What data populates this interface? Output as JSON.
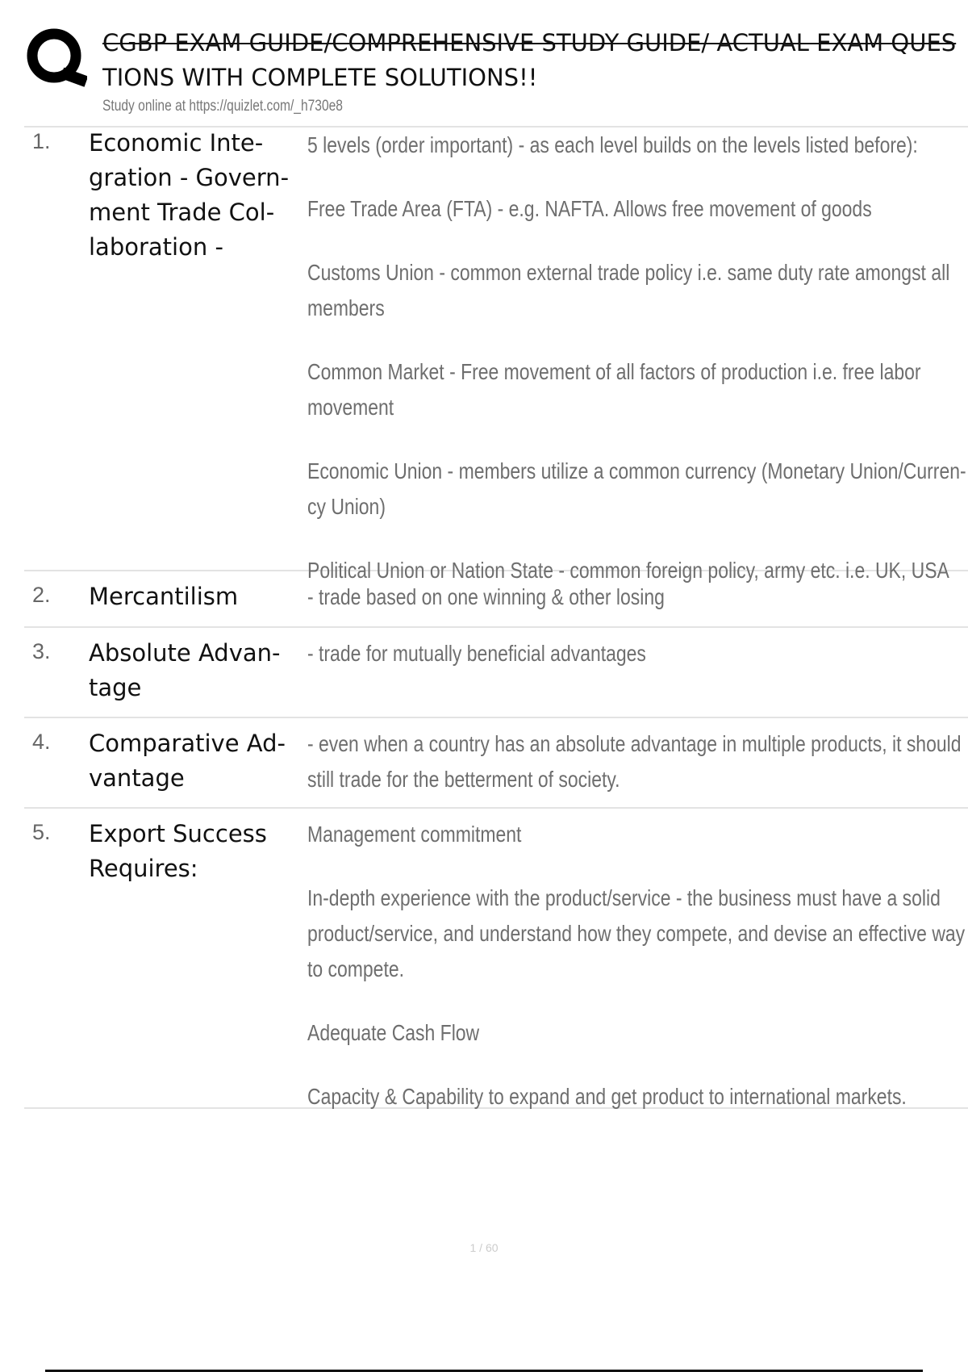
{
  "header": {
    "logo_icon": "quizlet-q-logo",
    "title_line1": "CGBP EXAM GUIDE/COMPREHENSIVE STUDY GUIDE/ ACTUAL EXAM QUES",
    "title_line2": "TIONS WITH COMPLETE SOLUTIONS!!",
    "study_link": "Study online at https://quizlet.com/_h730e8"
  },
  "terms": [
    {
      "num": "1.",
      "term": "Economic Inte-\ngration - Govern-\nment Trade Col-\nlaboration -",
      "definitions": [
        [
          "5 levels (order important) - as each level builds on the levels listed before):"
        ],
        [
          "Free Trade Area (FTA) - e.g. NAFTA. Allows free movement of goods"
        ],
        [
          "Customs Union - common external trade policy i.e. same duty rate amongst all",
          "members"
        ],
        [
          "Common Market - Free movement of all factors of production i.e. free labor",
          "movement"
        ],
        [
          "Economic Union - members utilize a common currency (Monetary Union/Curren-",
          "cy Union)"
        ],
        [
          "Political Union or Nation State - common foreign policy, army etc. i.e. UK, USA"
        ]
      ]
    },
    {
      "num": "2.",
      "term": "Mercantilism",
      "definitions": [
        [
          "- trade based on one winning & other losing"
        ]
      ]
    },
    {
      "num": "3.",
      "term": "Absolute Advan-\ntage",
      "definitions": [
        [
          "- trade for mutually beneficial advantages"
        ]
      ]
    },
    {
      "num": "4.",
      "term": "Comparative Ad-\nvantage",
      "definitions": [
        [
          "- even when a country has an absolute advantage in multiple products, it should",
          "still trade for the betterment of society."
        ]
      ]
    },
    {
      "num": "5.",
      "term": "Export Success\nRequires:",
      "definitions": [
        [
          "Management commitment"
        ],
        [
          "In-depth experience with the product/service - the business must have a solid",
          "product/service, and understand how they compete, and devise an effective way",
          "to compete."
        ],
        [
          "Adequate Cash Flow"
        ],
        [
          "Capacity & Capability to expand and get product to international markets."
        ]
      ]
    }
  ],
  "page_number": "1 / 60"
}
